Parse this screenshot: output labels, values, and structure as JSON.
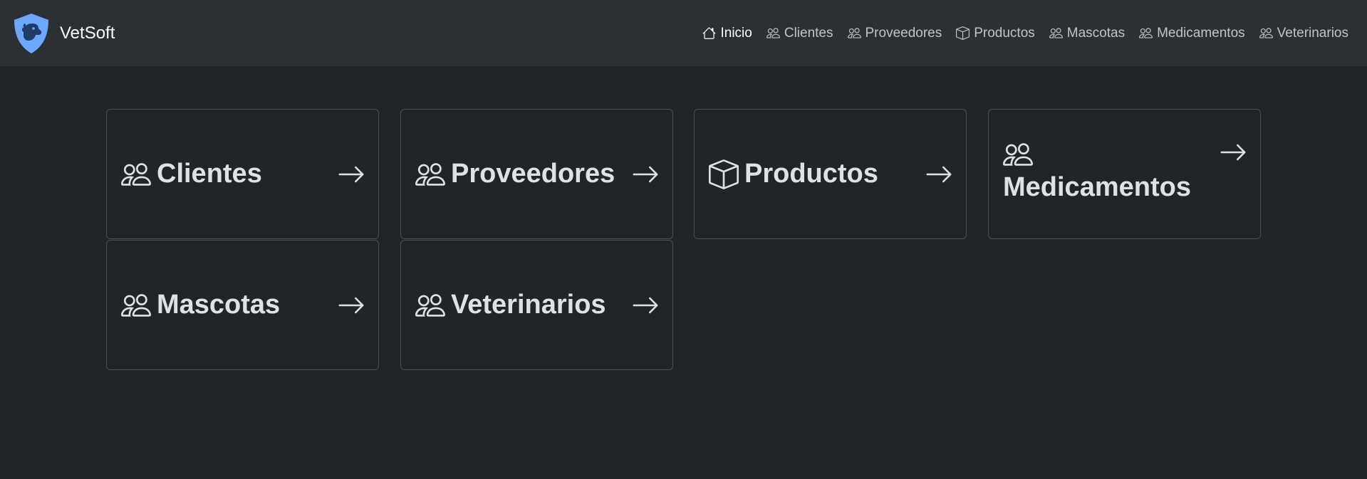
{
  "brand": {
    "name": "VetSoft",
    "logo": "shield-dog-logo"
  },
  "nav": {
    "items": [
      {
        "label": "Inicio",
        "icon": "house-icon",
        "active": true
      },
      {
        "label": "Clientes",
        "icon": "people-icon"
      },
      {
        "label": "Proveedores",
        "icon": "people-icon"
      },
      {
        "label": "Productos",
        "icon": "box-icon"
      },
      {
        "label": "Mascotas",
        "icon": "people-icon"
      },
      {
        "label": "Medicamentos",
        "icon": "people-icon"
      },
      {
        "label": "Veterinarios",
        "icon": "people-icon"
      }
    ]
  },
  "cards": [
    {
      "label": "Clientes",
      "icon": "people-icon",
      "arrow": "arrow-right-icon"
    },
    {
      "label": "Proveedores",
      "icon": "people-icon",
      "arrow": "arrow-right-icon"
    },
    {
      "label": "Productos",
      "icon": "box-icon",
      "arrow": "arrow-right-icon"
    },
    {
      "label": "Medicamentos",
      "icon": "people-icon",
      "arrow": "arrow-right-icon"
    },
    {
      "label": "Mascotas",
      "icon": "people-icon",
      "arrow": "arrow-right-icon"
    },
    {
      "label": "Veterinarios",
      "icon": "people-icon",
      "arrow": "arrow-right-icon"
    }
  ],
  "colors": {
    "background": "#212529",
    "navbar": "#2b3035",
    "card_border": "#495057",
    "logo_blue": "#6ea8fe",
    "text": "#dee2e6"
  }
}
